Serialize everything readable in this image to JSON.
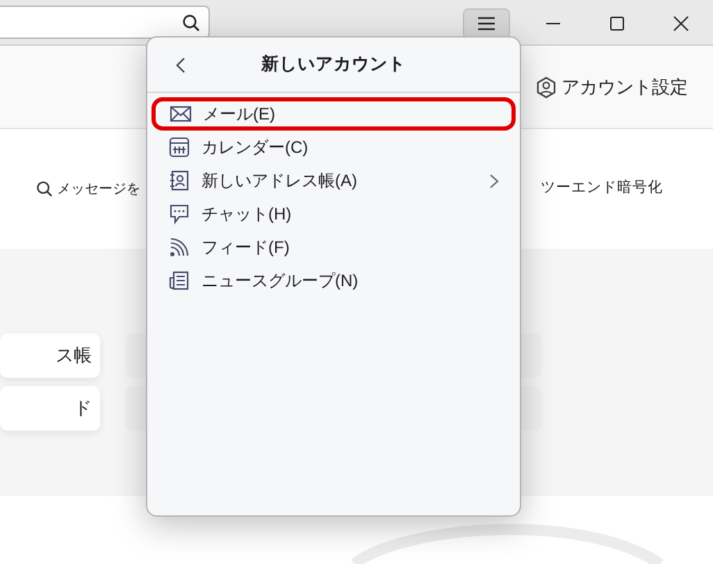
{
  "header": {
    "account_settings": "アカウント設定"
  },
  "content": {
    "search_messages": "メッセージを",
    "encryption": "ツーエンド暗号化",
    "cards": [
      "ス帳",
      "ド"
    ]
  },
  "menu": {
    "title": "新しいアカウント",
    "items": [
      {
        "label": "メール(E)",
        "kind": "mail",
        "highlighted": true,
        "submenu": false
      },
      {
        "label": "カレンダー(C)",
        "kind": "calendar",
        "highlighted": false,
        "submenu": false
      },
      {
        "label": "新しいアドレス帳(A)",
        "kind": "addressbook",
        "highlighted": false,
        "submenu": true
      },
      {
        "label": "チャット(H)",
        "kind": "chat",
        "highlighted": false,
        "submenu": false
      },
      {
        "label": "フィード(F)",
        "kind": "feed",
        "highlighted": false,
        "submenu": false
      },
      {
        "label": "ニュースグループ(N)",
        "kind": "news",
        "highlighted": false,
        "submenu": false
      }
    ]
  }
}
